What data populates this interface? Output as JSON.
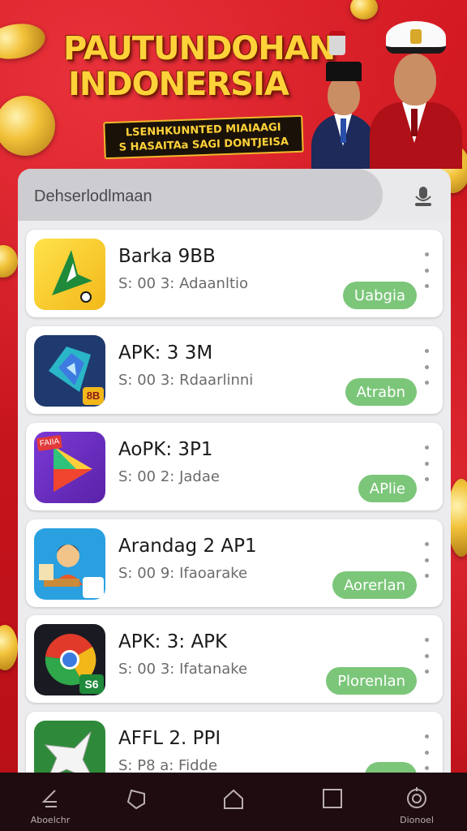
{
  "banner": {
    "title_line1": "PAUTUNDOHAN",
    "title_line2": "INDONERSIA",
    "subtitle_line1": "LSENHKUNNTED MIAIAAGI",
    "subtitle_line2": "S HASAITAa SAGI DONTJEISA"
  },
  "search": {
    "placeholder": "Dehserlodlmaan",
    "mic_icon": "microphone-icon"
  },
  "apps": [
    {
      "name": "Barka 9BB",
      "meta": "S: 00 3: Adaanltio",
      "action": "Uabgia",
      "icon": "yellow-arrow-icon"
    },
    {
      "name": "APK: 3 3M",
      "meta": "S: 00 3: Rdaarlinni",
      "action": "Atrabn",
      "icon": "blue-diamond-icon"
    },
    {
      "name": "AoPK: 3P1",
      "meta": "S: 00 2: Jadae",
      "action": "APlie",
      "icon": "play-triangle-icon"
    },
    {
      "name": "Arandag 2 AP1",
      "meta": "S: 00 9: Ifaoarake",
      "action": "Aorerlan",
      "icon": "person-desk-icon"
    },
    {
      "name": "APK: 3: APK",
      "meta": "S: 00 3: Ifatanake",
      "action": "Plorenlan",
      "icon": "chrome-like-icon"
    },
    {
      "name": "AFFL 2. PPI",
      "meta": "S: P8 a: Fidde",
      "action": "",
      "icon": "green-star-icon"
    }
  ],
  "icon_badges": {
    "blue": "8B",
    "purple": "FAIIA",
    "chrome": "S6"
  },
  "navbar": [
    {
      "label": "Aboelchr",
      "icon": "back-icon"
    },
    {
      "label": "",
      "icon": "home-outline-icon"
    },
    {
      "label": "",
      "icon": "house-icon"
    },
    {
      "label": "",
      "icon": "square-icon"
    },
    {
      "label": "Dionoel",
      "icon": "settings-dial-icon"
    }
  ],
  "colors": {
    "background_red": "#c8141c",
    "title_gold": "#ffd23a",
    "button_green": "#7cc67a",
    "navbar_dark": "#1e0c10"
  }
}
